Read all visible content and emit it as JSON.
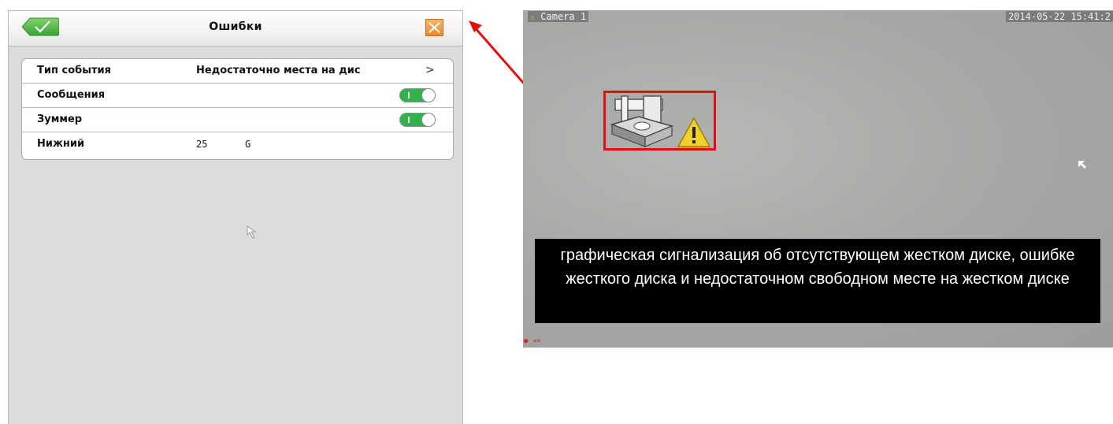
{
  "dialog": {
    "title": "Ошибки",
    "ok_icon": "checkmark-icon",
    "close_icon": "close-icon",
    "accent_green": "#55b947",
    "accent_orange": "#e88a2f",
    "rows": [
      {
        "label": "Тип события",
        "value": "Недостаточно места на дис",
        "chevron": ">"
      },
      {
        "label": "Сообщения",
        "toggle": true
      },
      {
        "label": "Зуммер",
        "toggle": true
      },
      {
        "label": "Нижний",
        "value": "25",
        "unit": "G"
      }
    ]
  },
  "camera": {
    "name": "Camera 1",
    "timestamp": "2014-05-22 15:41:2",
    "alarm_icons": [
      "hdd-icon",
      "warning-icon"
    ],
    "caption": "графическая сигнализация об отсутствующем жестком диске, ошибке жесткого диска и недостаточном свободном месте на жестком диске",
    "alarm_border_color": "#e01010"
  },
  "annotation": {
    "arrow_color": "#e01010"
  }
}
